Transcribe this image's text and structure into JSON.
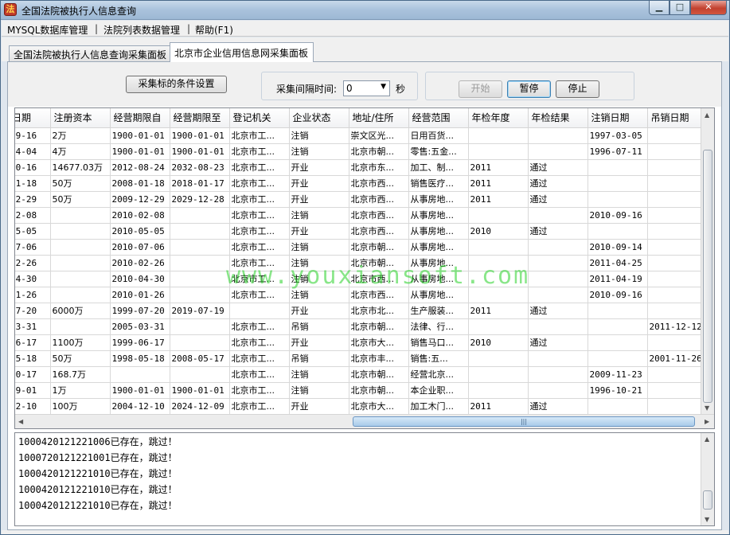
{
  "window": {
    "title": "全国法院被执行人信息查询"
  },
  "menu": {
    "items": [
      "MYSQL数据库管理",
      "法院列表数据管理",
      "帮助(F1)"
    ],
    "separator": "|"
  },
  "tabs": [
    "全国法院被执行人信息查询采集面板",
    "北京市企业信用信息网采集面板"
  ],
  "controls": {
    "condition_button": "采集标的条件设置",
    "interval_label": "采集间隔时间:",
    "interval_value": "0",
    "interval_unit": "秒",
    "start": "开始",
    "pause": "暂停",
    "stop": "停止"
  },
  "grid": {
    "columns": [
      "日期",
      "注册资本",
      "经营期限自",
      "经营期限至",
      "登记机关",
      "企业状态",
      "地址/住所",
      "经营范围",
      "年检年度",
      "年检结果",
      "注销日期",
      "吊销日期"
    ],
    "rows": [
      [
        "09-16",
        "2万",
        "1900-01-01",
        "1900-01-01",
        "北京市工...",
        "注销",
        "崇文区光...",
        "日用百货...",
        "",
        "",
        "1997-03-05",
        ""
      ],
      [
        "04-04",
        "4万",
        "1900-01-01",
        "1900-01-01",
        "北京市工...",
        "注销",
        "北京市朝...",
        "零售:五金...",
        "",
        "",
        "1996-07-11",
        ""
      ],
      [
        "10-16",
        "14677.03万",
        "2012-08-24",
        "2032-08-23",
        "北京市工...",
        "开业",
        "北京市东...",
        "加工、制...",
        "2011",
        "通过",
        "",
        ""
      ],
      [
        "01-18",
        "50万",
        "2008-01-18",
        "2018-01-17",
        "北京市工...",
        "开业",
        "北京市西...",
        "销售医疗...",
        "2011",
        "通过",
        "",
        ""
      ],
      [
        "12-29",
        "50万",
        "2009-12-29",
        "2029-12-28",
        "北京市工...",
        "开业",
        "北京市西...",
        "从事房地...",
        "2011",
        "通过",
        "",
        ""
      ],
      [
        "02-08",
        "",
        "2010-02-08",
        "",
        "北京市工...",
        "注销",
        "北京市西...",
        "从事房地...",
        "",
        "",
        "2010-09-16",
        ""
      ],
      [
        "05-05",
        "",
        "2010-05-05",
        "",
        "北京市工...",
        "开业",
        "北京市西...",
        "从事房地...",
        "2010",
        "通过",
        "",
        ""
      ],
      [
        "07-06",
        "",
        "2010-07-06",
        "",
        "北京市工...",
        "注销",
        "北京市朝...",
        "从事房地...",
        "",
        "",
        "2010-09-14",
        ""
      ],
      [
        "02-26",
        "",
        "2010-02-26",
        "",
        "北京市工...",
        "注销",
        "北京市朝...",
        "从事房地...",
        "",
        "",
        "2011-04-25",
        ""
      ],
      [
        "04-30",
        "",
        "2010-04-30",
        "",
        "北京市工...",
        "注销",
        "北京市西...",
        "从事房地...",
        "",
        "",
        "2011-04-19",
        ""
      ],
      [
        "01-26",
        "",
        "2010-01-26",
        "",
        "北京市工...",
        "注销",
        "北京市西...",
        "从事房地...",
        "",
        "",
        "2010-09-16",
        ""
      ],
      [
        "07-20",
        "6000万",
        "1999-07-20",
        "2019-07-19",
        "",
        "开业",
        "北京市北...",
        "生产服装...",
        "2011",
        "通过",
        "",
        ""
      ],
      [
        "03-31",
        "",
        "2005-03-31",
        "",
        "北京市工...",
        "吊销",
        "北京市朝...",
        "法律、行...",
        "",
        "",
        "",
        "2011-12-12"
      ],
      [
        "06-17",
        "1100万",
        "1999-06-17",
        "",
        "北京市工...",
        "开业",
        "北京市大...",
        "销售马口...",
        "2010",
        "通过",
        "",
        ""
      ],
      [
        "05-18",
        "50万",
        "1998-05-18",
        "2008-05-17",
        "北京市工...",
        "吊销",
        "北京市丰...",
        "销售:五...",
        "",
        "",
        "",
        "2001-11-26"
      ],
      [
        "10-17",
        "168.7万",
        "",
        "",
        "北京市工...",
        "注销",
        "北京市朝...",
        "经营北京...",
        "",
        "",
        "2009-11-23",
        ""
      ],
      [
        "09-01",
        "1万",
        "1900-01-01",
        "1900-01-01",
        "北京市工...",
        "注销",
        "北京市朝...",
        "本企业职...",
        "",
        "",
        "1996-10-21",
        ""
      ],
      [
        "12-10",
        "100万",
        "2004-12-10",
        "2024-12-09",
        "北京市工...",
        "开业",
        "北京市大...",
        "加工木门...",
        "2011",
        "通过",
        "",
        ""
      ]
    ]
  },
  "log": {
    "lines": [
      "1000420121221006已存在，跳过！",
      "1000720121221001已存在，跳过！",
      "1000420121221010已存在，跳过！",
      "1000420121221010已存在，跳过！",
      "1000420121221010已存在，跳过！"
    ]
  },
  "watermark": "www.youxiansoft.com"
}
